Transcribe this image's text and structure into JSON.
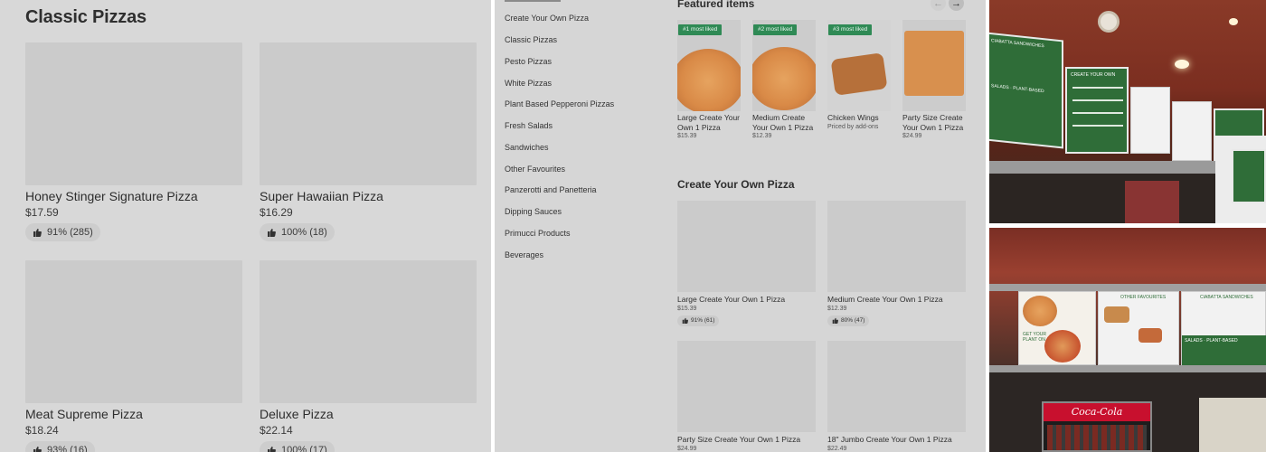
{
  "left": {
    "title": "Classic Pizzas",
    "cards": [
      {
        "name": "Honey Stinger Signature Pizza",
        "price": "$17.59",
        "rating": "91% (285)"
      },
      {
        "name": "Super Hawaiian Pizza",
        "price": "$16.29",
        "rating": "100% (18)"
      },
      {
        "name": "Meat Supreme Pizza",
        "price": "$18.24",
        "rating": "93% (16)"
      },
      {
        "name": "Deluxe Pizza",
        "price": "$22.14",
        "rating": "100% (17)"
      }
    ]
  },
  "mid": {
    "categories": [
      "Create Your Own Pizza",
      "Classic Pizzas",
      "Pesto Pizzas",
      "White Pizzas",
      "Plant Based Pepperoni Pizzas",
      "Fresh Salads",
      "Sandwiches",
      "Other Favourites",
      "Panzerotti and Panetteria",
      "Dipping Sauces",
      "Primucci Products",
      "Beverages"
    ],
    "featured_title": "Featured items",
    "featured": [
      {
        "tag": "#1 most liked",
        "name": "Large Create Your Own 1 Pizza",
        "price": "$15.39"
      },
      {
        "tag": "#2 most liked",
        "name": "Medium Create Your Own 1 Pizza",
        "price": "$12.39"
      },
      {
        "tag": "#3 most liked",
        "name": "Chicken Wings",
        "price": "Priced by add-ons"
      },
      {
        "tag": "",
        "name": "Party Size Create Your Own 1 Pizza",
        "price": "$24.99"
      }
    ],
    "section_title": "Create Your Own Pizza",
    "section_items": [
      {
        "name": "Large Create Your Own 1 Pizza",
        "price": "$15.39",
        "rating": "91% (61)"
      },
      {
        "name": "Medium Create Your Own 1 Pizza",
        "price": "$12.39",
        "rating": "80% (47)"
      },
      {
        "name": "Party Size Create Your Own 1 Pizza",
        "price": "$24.99",
        "rating": ""
      },
      {
        "name": "18\" Jumbo Create Your Own 1 Pizza",
        "price": "$22.49",
        "rating": ""
      }
    ],
    "arrow_prev": "←",
    "arrow_next": "→"
  },
  "photos": {
    "board_texts": {
      "ciabatta": "CIABATTA SANDWICHES",
      "salads": "SALADS",
      "plant_based": "PLANT-BASED",
      "create": "CREATE YOUR OWN",
      "other_favourites": "OTHER FAVOURITES",
      "plant_on": "GET YOUR PLANT ON",
      "coca_cola": "Coca-Cola"
    }
  },
  "colors": {
    "panel_bg": "#d8d8d8",
    "tag_green": "#2f8a55",
    "board_green": "#2f6d38",
    "ceiling_red": "#8a3a28"
  }
}
